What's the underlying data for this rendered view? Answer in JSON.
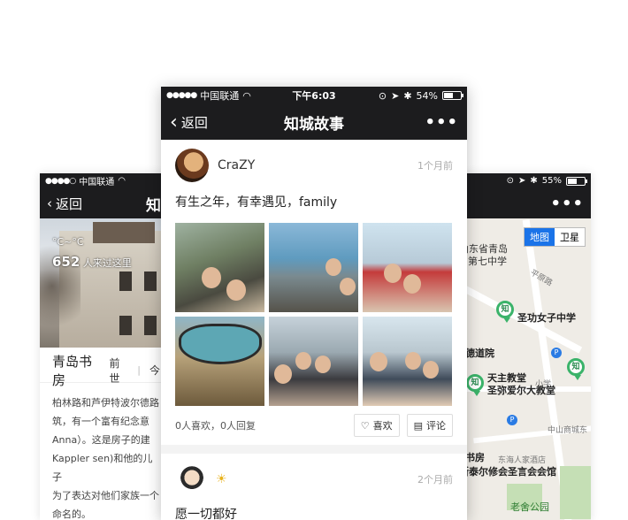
{
  "left_phone": {
    "status": {
      "carrier": "中国联通"
    },
    "nav": {
      "back_label": "返回",
      "title": "知"
    },
    "photo": {
      "temp": "°C~°C",
      "visit_count": "652",
      "visit_suffix": "人来过这里"
    },
    "place_name": "青岛书房",
    "tabs": [
      "前世",
      "今"
    ],
    "description": "柏林路和芦伊特波尔德路\n筑，有一个富有纪念意\nAnna）。这是房子的建\nKappler sen)和他的儿子\n为了表达对他们家族一个\n命名的。"
  },
  "center_phone": {
    "status": {
      "carrier": "中国联通",
      "time": "下午6:03",
      "battery": "54%",
      "battery_level": 0.54
    },
    "nav": {
      "back_label": "返回",
      "title": "知城故事",
      "more": "•••"
    },
    "posts": [
      {
        "username": "CraZY",
        "time": "1个月前",
        "text": "有生之年，有幸遇见，family",
        "stats": "0人喜欢，0人回复",
        "like_label": "喜欢",
        "comment_label": "评论"
      },
      {
        "username": "",
        "time": "2个月前",
        "text": "愿一切都好"
      }
    ]
  },
  "right_phone": {
    "status": {
      "battery": "55%",
      "battery_level": 0.55
    },
    "nav": {
      "more": "•••"
    },
    "map": {
      "toggle": [
        "地图",
        "卫星"
      ],
      "labels": {
        "school_top_a": "山东省青岛",
        "school_top_b": "第七中学",
        "road1": "平原路",
        "shenggong": "圣功女子中学",
        "daoyuan": "东德道院",
        "catholic_a": "天主教堂",
        "catholic_b": "圣弥爱尔大教堂",
        "xiaoxue": "小学",
        "zhongshan": "中山商城东",
        "shufang": "岛书房",
        "donghai": "东海人家酒店",
        "sitaier": "斯泰尔修会圣言会会馆",
        "laoshe": "老舍公园"
      }
    }
  }
}
